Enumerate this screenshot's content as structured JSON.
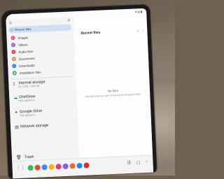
{
  "sidebar": {
    "recent_label": "Recent files",
    "items": [
      {
        "label": "Images",
        "color": "#e85c7b"
      },
      {
        "label": "Videos",
        "color": "#9b5de5"
      },
      {
        "label": "Audio files",
        "color": "#e0457b"
      },
      {
        "label": "Documents",
        "color": "#e8934a"
      },
      {
        "label": "Downloads",
        "color": "#3c8dde"
      },
      {
        "label": "Installation files",
        "color": "#3bb36b"
      }
    ],
    "storage": [
      {
        "name": "Internal storage",
        "sub": "22.2 GB / 256 GB"
      },
      {
        "name": "OneDrive",
        "sub": "Not signed in"
      },
      {
        "name": "Google Drive",
        "sub": "Not signed in"
      },
      {
        "name": "Network storage",
        "sub": ""
      }
    ],
    "trash_label": "Trash"
  },
  "main": {
    "title": "Recent files",
    "empty_title": "No files",
    "empty_desc": "Any files that you open or download will appear here."
  },
  "colors": {
    "accent": "#2f6fc4",
    "selected_bg": "#cfe0f4"
  }
}
